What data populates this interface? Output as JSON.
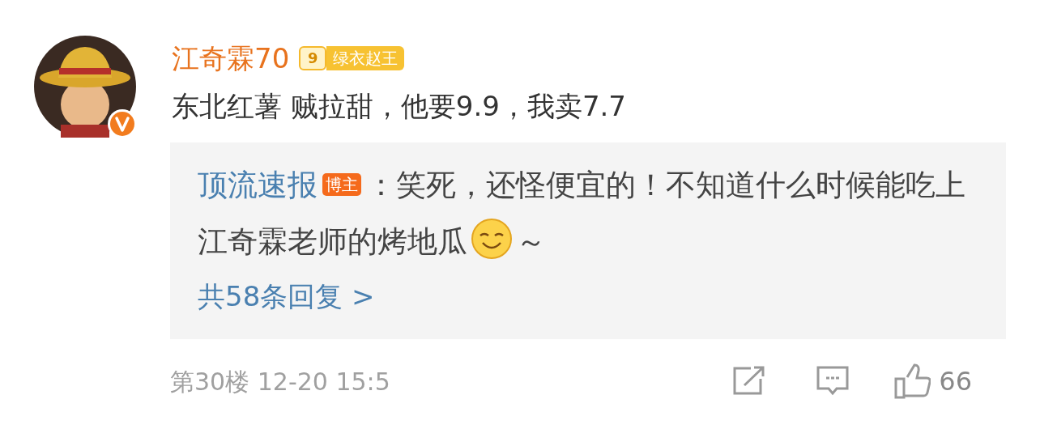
{
  "comment": {
    "author": "江奇霖70",
    "level_badge": {
      "level": "9",
      "title": "绿衣赵王"
    },
    "verified": true,
    "text": "东北红薯 贼拉甜，他要9.9，我卖7.7"
  },
  "reply_preview": {
    "author": "顶流速报",
    "author_tag": "博主",
    "text_before_emoji": "：笑死，还怪便宜的！不知道什么时候能吃上江奇霖老师的烤地瓜",
    "text_after_emoji": "～",
    "more_link": "共58条回复 >"
  },
  "footer": {
    "meta": "第30楼 12-20 15:5",
    "likes": "66"
  }
}
